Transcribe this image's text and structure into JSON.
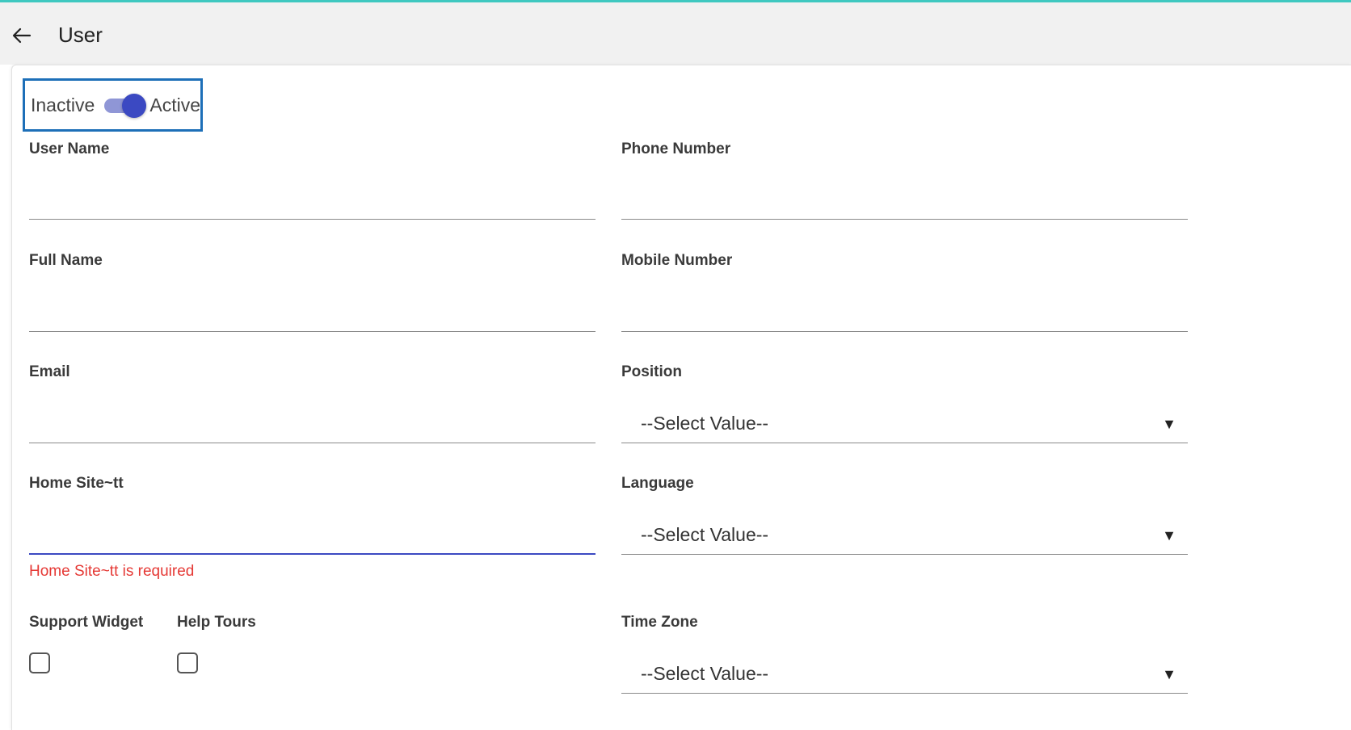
{
  "header": {
    "title": "User",
    "back_icon": "arrow-left-icon"
  },
  "status": {
    "inactive_label": "Inactive",
    "active_label": "Active",
    "is_active": true
  },
  "fields": {
    "user_name": {
      "label": "User Name",
      "value": ""
    },
    "phone_number": {
      "label": "Phone Number",
      "value": ""
    },
    "full_name": {
      "label": "Full Name",
      "value": ""
    },
    "mobile_number": {
      "label": "Mobile Number",
      "value": ""
    },
    "email": {
      "label": "Email",
      "value": ""
    },
    "position": {
      "label": "Position",
      "value": "--Select Value--"
    },
    "home_site": {
      "label": "Home Site~tt",
      "value": "",
      "error": "Home Site~tt is required"
    },
    "language": {
      "label": "Language",
      "value": "--Select Value--"
    },
    "support_widget": {
      "label": "Support Widget",
      "checked": false
    },
    "help_tours": {
      "label": "Help Tours",
      "checked": false
    },
    "time_zone": {
      "label": "Time Zone",
      "value": "--Select Value--"
    }
  },
  "colors": {
    "accent": "#3b49c2",
    "error": "#e53935",
    "highlight_border": "#1d6fb8",
    "top_line": "#3fc8c0"
  }
}
